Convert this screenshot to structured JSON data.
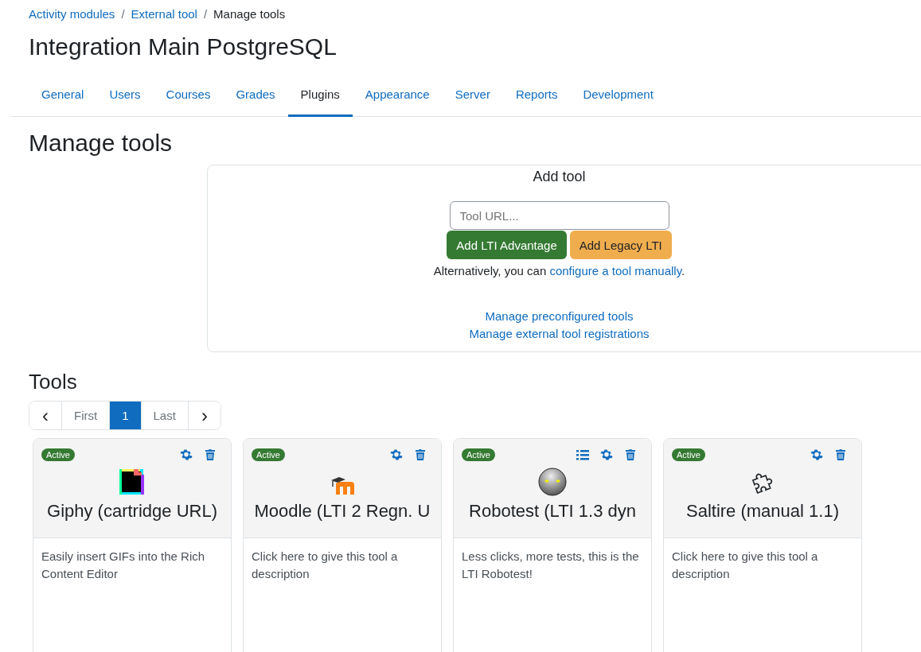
{
  "breadcrumb": [
    {
      "label": "Activity modules",
      "link": true
    },
    {
      "separator": "/",
      "label": "External tool",
      "link": true
    },
    {
      "separator": "/",
      "label": "Manage tools",
      "link": false
    }
  ],
  "page_title": "Integration Main PostgreSQL",
  "tabs": [
    {
      "label": "General",
      "selected": false
    },
    {
      "label": "Users",
      "selected": false
    },
    {
      "label": "Courses",
      "selected": false
    },
    {
      "label": "Grades",
      "selected": false
    },
    {
      "label": "Plugins",
      "selected": true
    },
    {
      "label": "Appearance",
      "selected": false
    },
    {
      "label": "Server",
      "selected": false
    },
    {
      "label": "Reports",
      "selected": false
    },
    {
      "label": "Development",
      "selected": false
    }
  ],
  "heading": "Manage tools",
  "add_tool": {
    "title": "Add tool",
    "placeholder": "Tool URL...",
    "advantage_button": "Add LTI Advantage",
    "legacy_button": "Add Legacy LTI",
    "alt_text": "Alternatively, you can ",
    "alt_link": "configure a tool manually",
    "alt_end": ".",
    "links": [
      "Manage preconfigured tools",
      "Manage external tool registrations"
    ]
  },
  "tools_heading": "Tools",
  "pagination": [
    {
      "label": "‹",
      "kind": "prev",
      "selected": false
    },
    {
      "label": "First",
      "kind": "page",
      "selected": false
    },
    {
      "label": "1",
      "kind": "page",
      "selected": true
    },
    {
      "label": "Last",
      "kind": "page",
      "selected": false
    },
    {
      "label": "›",
      "kind": "next",
      "selected": false
    }
  ],
  "tools": [
    {
      "status": "Active",
      "active": true,
      "actions": [
        {
          "kind": "settings"
        },
        {
          "kind": "delete"
        }
      ],
      "name": "Giphy (cartridge URL)",
      "description": "Easily insert GIFs into the Rich Content Editor"
    },
    {
      "status": "Active",
      "active": true,
      "actions": [
        {
          "kind": "settings"
        },
        {
          "kind": "delete"
        }
      ],
      "name": "Moodle (LTI 2 Regn. U",
      "description": "Click here to give this tool a description"
    },
    {
      "status": "Active",
      "active": true,
      "actions": [
        {
          "kind": "list"
        },
        {
          "kind": "settings"
        },
        {
          "kind": "delete"
        }
      ],
      "name": "Robotest (LTI 1.3 dyn",
      "description": "Less clicks, more tests, this is the LTI Robotest!"
    },
    {
      "status": "Active",
      "active": true,
      "actions": [
        {
          "kind": "settings"
        },
        {
          "kind": "delete"
        }
      ],
      "name": "Saltire (manual 1.1)",
      "description": "Click here to give this tool a description"
    }
  ]
}
